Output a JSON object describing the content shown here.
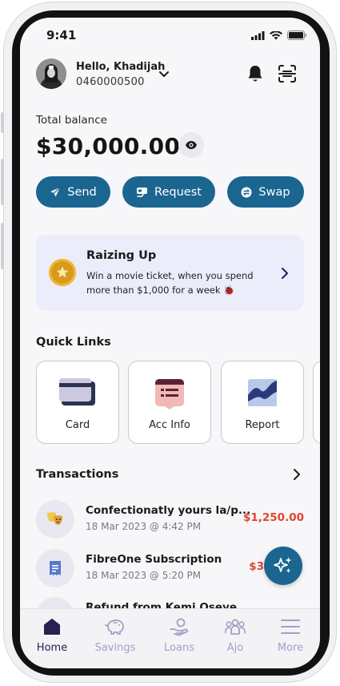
{
  "status": {
    "time": "9:41"
  },
  "header": {
    "greeting": "Hello, Khadijah",
    "phone": "0460000500"
  },
  "balance": {
    "label": "Total balance",
    "amount": "$30,000.00"
  },
  "actions": [
    {
      "label": "Send",
      "icon": "send-icon"
    },
    {
      "label": "Request",
      "icon": "request-icon"
    },
    {
      "label": "Swap",
      "icon": "swap-icon"
    }
  ],
  "promo": {
    "title": "Raizing Up",
    "description": "Win a movie ticket, when you spend more than $1,000 for a week 🐞"
  },
  "quick_links": {
    "title": "Quick Links",
    "items": [
      {
        "label": "Card",
        "icon": "card-icon"
      },
      {
        "label": "Acc Info",
        "icon": "account-info-icon"
      },
      {
        "label": "Report",
        "icon": "report-icon"
      }
    ]
  },
  "transactions": {
    "title": "Transactions",
    "items": [
      {
        "name": "Confectionatly yours  la/p...",
        "date": "18 Mar 2023 @ 4:42 PM",
        "amount": "$1,250.00",
        "icon": "theater-masks-icon"
      },
      {
        "name": "FibreOne Subscription",
        "date": "18 Mar 2023 @ 5:20 PM",
        "amount": "$3",
        "icon": "receipt-icon"
      },
      {
        "name": "Refund from Kemi Oseye",
        "date": "",
        "amount": "",
        "icon": "refund-icon"
      }
    ]
  },
  "nav": [
    {
      "label": "Home",
      "active": true,
      "icon": "home-icon"
    },
    {
      "label": "Savings",
      "active": false,
      "icon": "piggy-bank-icon"
    },
    {
      "label": "Loans",
      "active": false,
      "icon": "loan-hand-icon"
    },
    {
      "label": "Ajo",
      "active": false,
      "icon": "group-icon"
    },
    {
      "label": "More",
      "active": false,
      "icon": "menu-icon"
    }
  ],
  "colors": {
    "primary": "#1b6591",
    "accent_text": "#e0452f",
    "promo_bg": "#ecedfb",
    "nav_active": "#2a2150",
    "nav_inactive": "#a59ec4"
  }
}
